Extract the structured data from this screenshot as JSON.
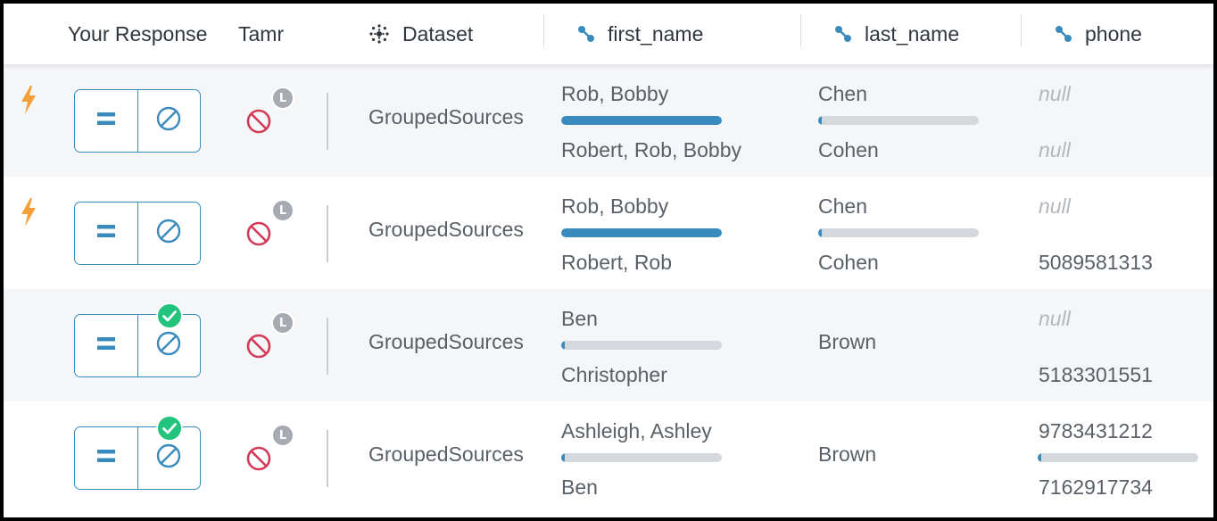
{
  "header": {
    "your_response": "Your Response",
    "tamr": "Tamr",
    "dataset": "Dataset",
    "first_name": "first_name",
    "last_name": "last_name",
    "phone": "phone"
  },
  "colors": {
    "accent": "#3a8bbd",
    "danger": "#d23b57",
    "success": "#22c47d",
    "bolt": "#f4a03a"
  },
  "rows": [
    {
      "has_bolt": true,
      "has_check": false,
      "tamr_badge": "L",
      "dataset": "GroupedSources",
      "first_name": {
        "top": "Rob, Bobby",
        "bottom": "Robert, Rob, Bobby",
        "similarity": 1.0
      },
      "last_name": {
        "top": "Chen",
        "bottom": "Cohen",
        "similarity": 0.02
      },
      "phone": {
        "top": "null",
        "bottom": "null",
        "top_null": true,
        "bottom_null": true
      }
    },
    {
      "has_bolt": true,
      "has_check": false,
      "tamr_badge": "L",
      "dataset": "GroupedSources",
      "first_name": {
        "top": "Rob, Bobby",
        "bottom": "Robert, Rob",
        "similarity": 1.0
      },
      "last_name": {
        "top": "Chen",
        "bottom": "Cohen",
        "similarity": 0.02
      },
      "phone": {
        "top": "null",
        "bottom": "5089581313",
        "top_null": true,
        "bottom_null": false
      }
    },
    {
      "has_bolt": false,
      "has_check": true,
      "tamr_badge": "L",
      "dataset": "GroupedSources",
      "first_name": {
        "top": "Ben",
        "bottom": "Christopher",
        "similarity": 0.02
      },
      "last_name": {
        "single": "Brown"
      },
      "phone": {
        "top": "null",
        "bottom": "5183301551",
        "top_null": true,
        "bottom_null": false
      }
    },
    {
      "has_bolt": false,
      "has_check": true,
      "tamr_badge": "L",
      "dataset": "GroupedSources",
      "first_name": {
        "top": "Ashleigh, Ashley",
        "bottom": "Ben",
        "similarity": 0.02
      },
      "last_name": {
        "single": "Brown"
      },
      "phone": {
        "top": "9783431212",
        "bottom": "7162917734",
        "top_null": false,
        "bottom_null": false,
        "similarity": 0.02
      }
    }
  ]
}
